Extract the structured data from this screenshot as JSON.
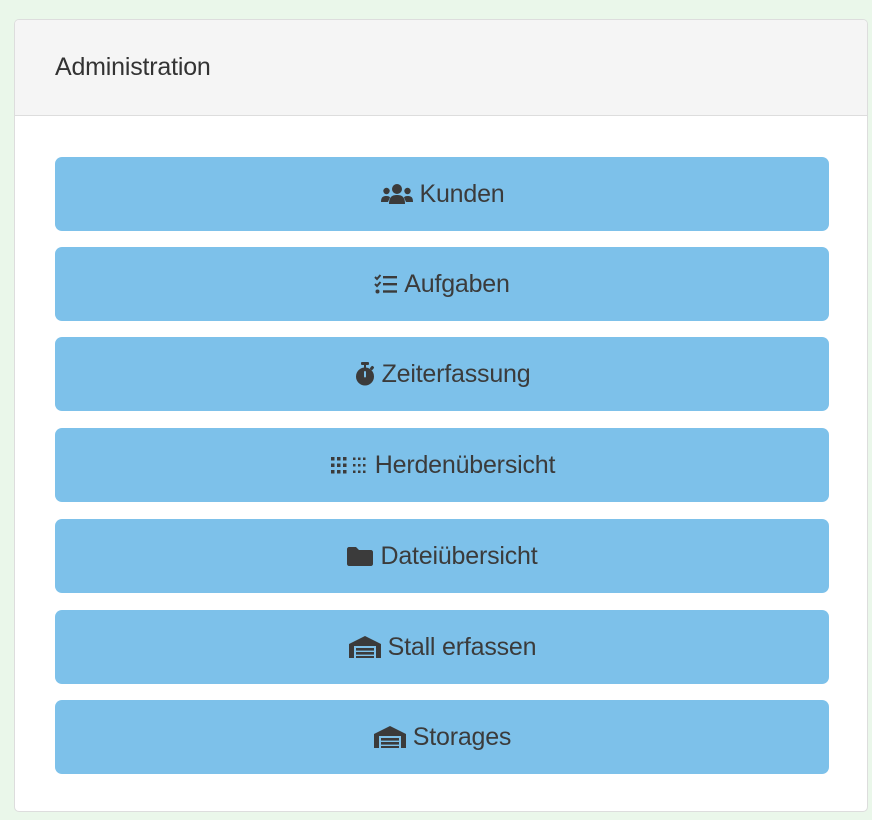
{
  "panel": {
    "title": "Administration"
  },
  "buttons": [
    {
      "label": "Kunden",
      "icon": "users-icon"
    },
    {
      "label": "Aufgaben",
      "icon": "tasks-icon"
    },
    {
      "label": "Zeiterfassung",
      "icon": "stopwatch-icon"
    },
    {
      "label": "Herdenübersicht",
      "icon": "herd-dots-icon"
    },
    {
      "label": "Dateiübersicht",
      "icon": "folder-icon"
    },
    {
      "label": "Stall erfassen",
      "icon": "warehouse-icon"
    },
    {
      "label": "Storages",
      "icon": "warehouse-icon"
    }
  ],
  "colors": {
    "page_background": "#eaf7ea",
    "button_background": "#7dc1ea",
    "button_text": "#3b3b3b",
    "heading_background": "#f5f5f5"
  }
}
